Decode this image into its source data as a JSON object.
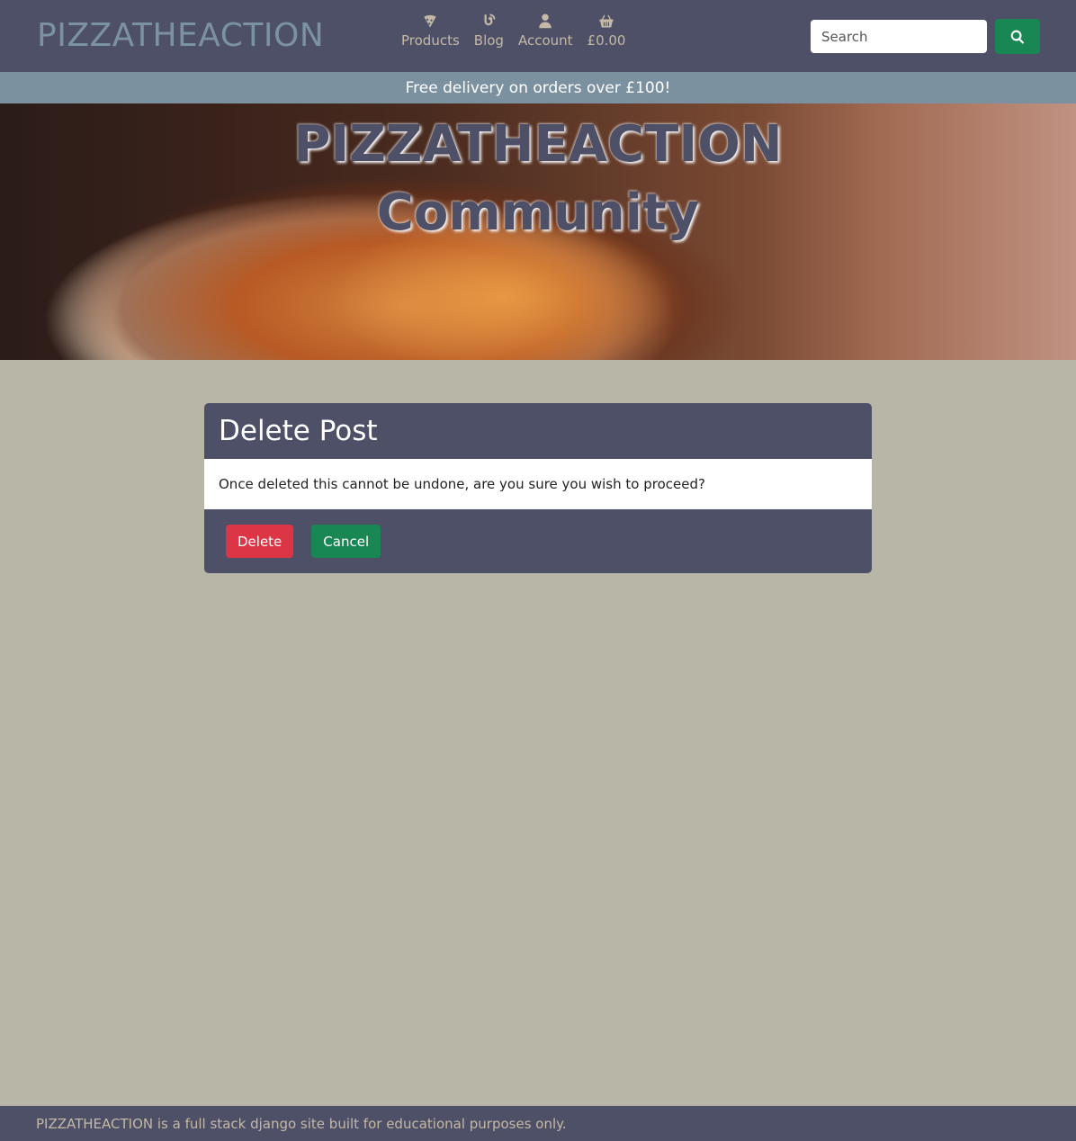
{
  "navbar": {
    "brand": "PIZZATHEACTION",
    "items": [
      {
        "label": "Products",
        "icon": "pizza-slice-icon"
      },
      {
        "label": "Blog",
        "icon": "blog-icon"
      },
      {
        "label": "Account",
        "icon": "user-icon"
      },
      {
        "label": "£0.00",
        "icon": "basket-icon"
      }
    ],
    "search": {
      "placeholder": "Search",
      "value": ""
    },
    "search_button_icon": "search-icon"
  },
  "banner": {
    "text": "Free delivery on orders over £100!"
  },
  "hero": {
    "title_line1": "PIZZATHEACTION",
    "title_line2": "Community"
  },
  "card": {
    "title": "Delete Post",
    "message": "Once deleted this cannot be undone, are you sure you wish to proceed?",
    "delete_label": "Delete",
    "cancel_label": "Cancel"
  },
  "footer": {
    "text": "PIZZATHEACTION is a full stack django site built for educational purposes only."
  },
  "colors": {
    "navbar": "#4d5066",
    "brand": "#7b91a4",
    "nav_text": "#c4b8a6",
    "banner": "#7b91a0",
    "page_background": "#b8b7a7",
    "delete": "#dc3545",
    "success": "#198754"
  }
}
